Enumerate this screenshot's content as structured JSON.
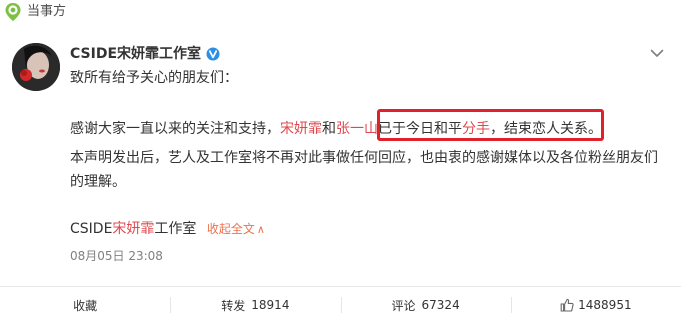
{
  "topbar": {
    "source_name": "当事方"
  },
  "post": {
    "author": "CSIDE宋妍霏工作室",
    "greeting": "致所有给予关心的朋友们：",
    "para1": {
      "text_a": "感谢大家一直以来的关注和支持，",
      "name_1": "宋妍霏",
      "conj": "和",
      "name_2": "张一山",
      "text_b": "已于今日和平",
      "breakup": "分手",
      "text_c": "，结束恋人关系。"
    },
    "para2": "本声明发出后，艺人及工作室将不再对此事做任何回应，也由衷的感谢媒体以及各位粉丝朋友们的理解。",
    "signature_prefix": "CSIDE",
    "signature_name": "宋妍霏",
    "signature_suffix": "工作室",
    "collapse_label": "收起全文",
    "collapse_arrow": "∧",
    "timestamp": "08月05日 23:08"
  },
  "actions": {
    "favorite_label": "收藏",
    "repost_label": "转发",
    "repost_count": "18914",
    "comment_label": "评论",
    "comment_count": "67324",
    "like_count": "1488951"
  },
  "colors": {
    "highlight_box": "#e0202a",
    "name_link": "#e0484e",
    "collapse_link": "#eb7350",
    "source_logo": "#7bc043",
    "verified_badge": "#2b8fe6"
  },
  "icons": {
    "source_logo": "location-pin-icon",
    "verified": "verified-badge-icon",
    "menu": "chevron-down-icon",
    "like": "thumbs-up-icon"
  }
}
